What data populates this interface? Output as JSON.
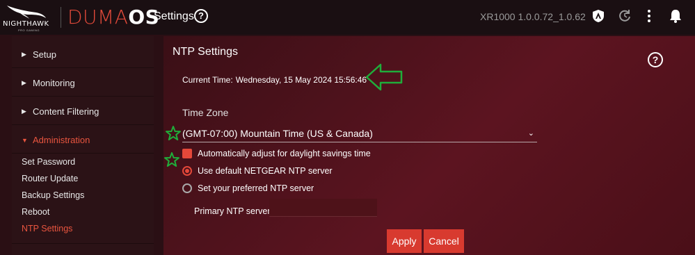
{
  "header": {
    "brand_nighthawk": "NIGHTHAWK",
    "brand_sub": "PRO GAMING",
    "brand_duma": "DUMA",
    "brand_os": "OS",
    "title": "Settings",
    "help_glyph": "?",
    "firmware": "XR1000 1.0.0.72_1.0.62",
    "icons": [
      "account-shield-icon",
      "refresh-icon",
      "more-vertical-icon",
      "bell-icon"
    ]
  },
  "sidebar": {
    "groups": [
      {
        "label": "Setup",
        "expanded": false
      },
      {
        "label": "Monitoring",
        "expanded": false
      },
      {
        "label": "Content Filtering",
        "expanded": false
      },
      {
        "label": "Administration",
        "expanded": true
      }
    ],
    "sub_items": [
      {
        "label": "Set Password",
        "active": false
      },
      {
        "label": "Router Update",
        "active": false
      },
      {
        "label": "Backup Settings",
        "active": false
      },
      {
        "label": "Reboot",
        "active": false
      },
      {
        "label": "NTP Settings",
        "active": true
      }
    ]
  },
  "main": {
    "title": "NTP Settings",
    "help_glyph": "?",
    "current_time_label": "Current Time:",
    "current_time_value": "Wednesday, 15 May 2024 15:56:46",
    "timezone_label": "Time Zone",
    "timezone_value": "(GMT-07:00) Mountain Time (US & Canada)",
    "dst_label": "Automatically adjust for daylight savings time",
    "dst_checked": true,
    "radio_default_label": "Use default NETGEAR NTP server",
    "radio_custom_label": "Set your preferred NTP server",
    "selected_server_option": "default",
    "primary_ntp_label": "Primary NTP server:",
    "primary_ntp_value": "",
    "apply_label": "Apply",
    "cancel_label": "Cancel"
  },
  "colors": {
    "accent": "#e5483a",
    "annotation_green": "#1fae3a",
    "topbar_bg": "#1a0f12",
    "sidebar_bg": "#2b1216",
    "main_bg": "#5c1420"
  }
}
